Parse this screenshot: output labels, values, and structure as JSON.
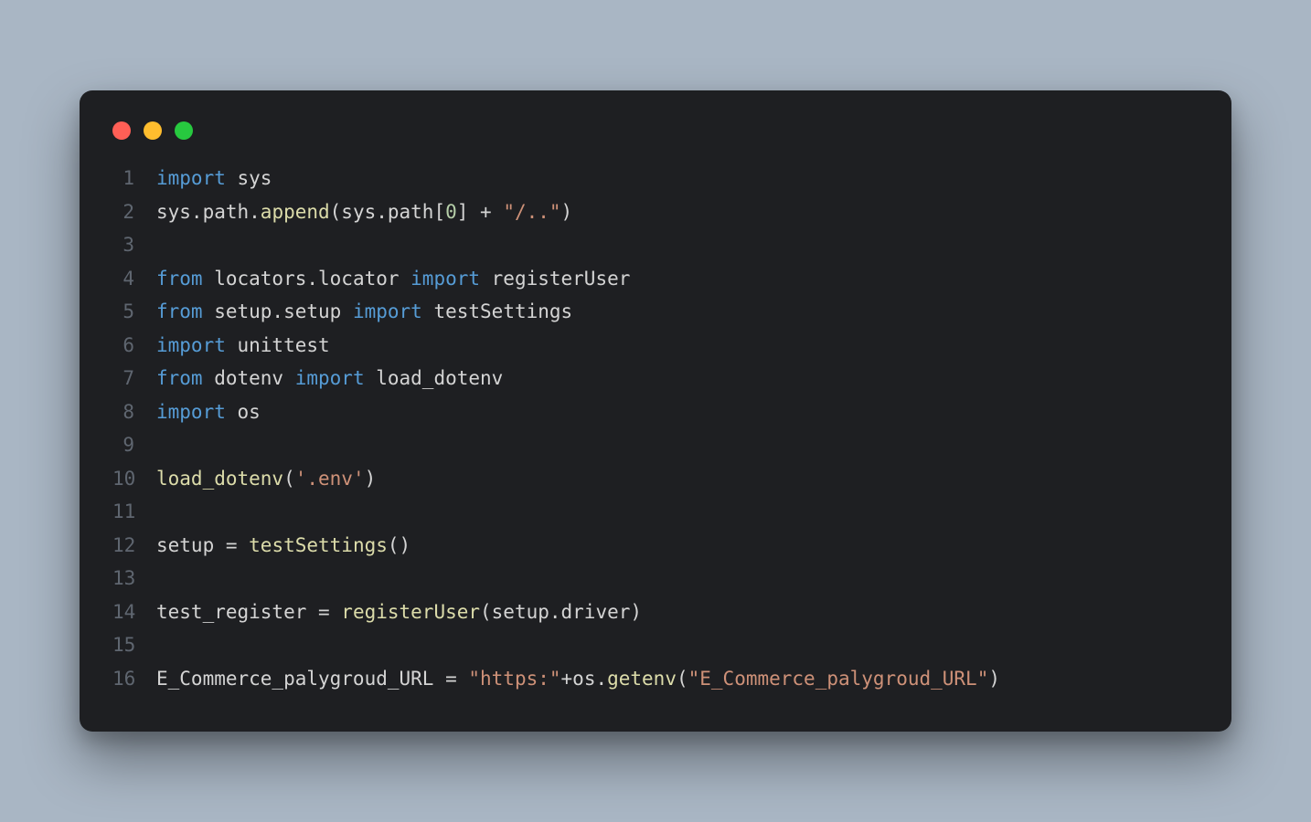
{
  "colors": {
    "background": "#a9b6c4",
    "editor_bg": "#1e1f22",
    "line_number": "#5f6670",
    "keyword": "#569cd6",
    "default_text": "#d4d4d4",
    "string": "#ce9178",
    "number": "#b5cea8",
    "function": "#dcdcaa",
    "dot_red": "#ff5f56",
    "dot_yellow": "#ffbd2e",
    "dot_green": "#27c93f"
  },
  "code": {
    "lines": [
      [
        {
          "t": "import",
          "c": "kw"
        },
        {
          "t": " sys",
          "c": "txt"
        }
      ],
      [
        {
          "t": "sys.path.",
          "c": "txt"
        },
        {
          "t": "append",
          "c": "fn"
        },
        {
          "t": "(sys.path[",
          "c": "txt"
        },
        {
          "t": "0",
          "c": "num"
        },
        {
          "t": "] + ",
          "c": "txt"
        },
        {
          "t": "\"/..\"",
          "c": "str"
        },
        {
          "t": ")",
          "c": "txt"
        }
      ],
      [],
      [
        {
          "t": "from",
          "c": "kw"
        },
        {
          "t": " locators.locator ",
          "c": "txt"
        },
        {
          "t": "import",
          "c": "kw"
        },
        {
          "t": " registerUser",
          "c": "txt"
        }
      ],
      [
        {
          "t": "from",
          "c": "kw"
        },
        {
          "t": " setup.setup ",
          "c": "txt"
        },
        {
          "t": "import",
          "c": "kw"
        },
        {
          "t": " testSettings",
          "c": "txt"
        }
      ],
      [
        {
          "t": "import",
          "c": "kw"
        },
        {
          "t": " unittest",
          "c": "txt"
        }
      ],
      [
        {
          "t": "from",
          "c": "kw"
        },
        {
          "t": " dotenv ",
          "c": "txt"
        },
        {
          "t": "import",
          "c": "kw"
        },
        {
          "t": " load_dotenv",
          "c": "txt"
        }
      ],
      [
        {
          "t": "import",
          "c": "kw"
        },
        {
          "t": " os",
          "c": "txt"
        }
      ],
      [],
      [
        {
          "t": "load_dotenv",
          "c": "fn"
        },
        {
          "t": "(",
          "c": "txt"
        },
        {
          "t": "'.env'",
          "c": "str"
        },
        {
          "t": ")",
          "c": "txt"
        }
      ],
      [],
      [
        {
          "t": "setup = ",
          "c": "txt"
        },
        {
          "t": "testSettings",
          "c": "fn"
        },
        {
          "t": "()",
          "c": "txt"
        }
      ],
      [],
      [
        {
          "t": "test_register = ",
          "c": "txt"
        },
        {
          "t": "registerUser",
          "c": "fn"
        },
        {
          "t": "(setup.driver)",
          "c": "txt"
        }
      ],
      [],
      [
        {
          "t": "E_Commerce_palygroud_URL = ",
          "c": "txt"
        },
        {
          "t": "\"https:\"",
          "c": "str"
        },
        {
          "t": "+os.",
          "c": "txt"
        },
        {
          "t": "getenv",
          "c": "fn"
        },
        {
          "t": "(",
          "c": "txt"
        },
        {
          "t": "\"E_Commerce_palygroud_URL\"",
          "c": "str"
        },
        {
          "t": ")",
          "c": "txt"
        }
      ]
    ]
  }
}
